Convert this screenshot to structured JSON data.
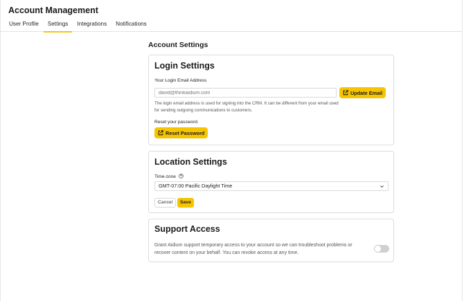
{
  "app": {
    "title": "Account Management"
  },
  "tabs": [
    {
      "label": "User Profile",
      "active": false
    },
    {
      "label": "Settings",
      "active": true
    },
    {
      "label": "Integrations",
      "active": false
    },
    {
      "label": "Notifications",
      "active": false
    }
  ],
  "main": {
    "title": "Account Settings"
  },
  "login": {
    "title": "Login Settings",
    "email_label": "Your Login Email Address",
    "email_placeholder": "david@thinkaidium.com",
    "update_button": "Update Email",
    "help_text": "The login email address is used for signing into the CRM. It can be different from your email used for sending outgoing communications to customers.",
    "reset_label": "Reset your password.",
    "reset_button": "Reset Password"
  },
  "location": {
    "title": "Location Settings",
    "timezone_label": "Time-zone",
    "timezone_value": "GMT-07:00 Pacific Daylight Time",
    "cancel_button": "Cancel",
    "save_button": "Save"
  },
  "support": {
    "title": "Support Access",
    "description": "Grant Aidium support temporary access to your account so we can troubleshoot problems or recover content on your behalf. You can revoke access at any time.",
    "enabled": false
  },
  "colors": {
    "accent": "#f7c500",
    "tab_underline": "#f5c400",
    "border": "#dcdcdc"
  },
  "icons": [
    "external-link-icon",
    "help-circle-icon",
    "chevron-down-icon"
  ]
}
